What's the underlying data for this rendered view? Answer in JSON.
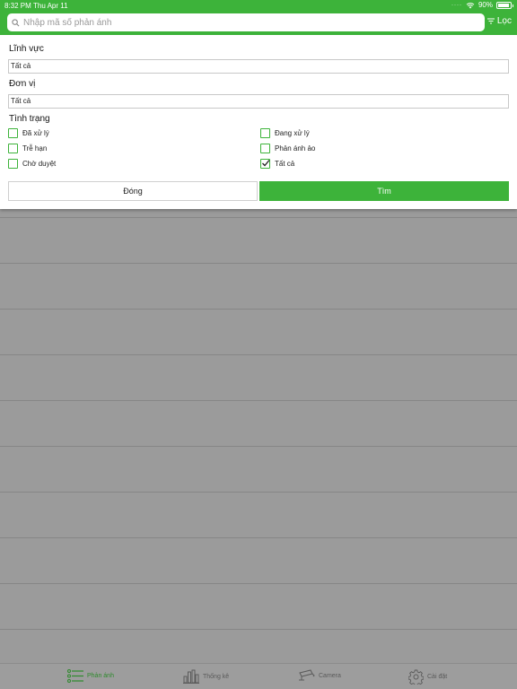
{
  "status": {
    "time": "8:32 PM",
    "date": "Thu Apr 11",
    "battery": "90%",
    "battery_level": 0.9
  },
  "search": {
    "placeholder": "Nhập mã số phản ánh",
    "value": ""
  },
  "header": {
    "filter_label": "Lọc"
  },
  "filter": {
    "field_label": "Lĩnh vực",
    "field_value": "Tất cả",
    "unit_label": "Đơn vị",
    "unit_value": "Tất cả",
    "status_label": "Tình trạng",
    "options": [
      {
        "label": "Đã xử lý",
        "checked": false
      },
      {
        "label": "Đang xử lý",
        "checked": false
      },
      {
        "label": "Trễ hạn",
        "checked": false
      },
      {
        "label": "Phản ánh ảo",
        "checked": false
      },
      {
        "label": "Chờ duyệt",
        "checked": false
      },
      {
        "label": "Tất cả",
        "checked": true
      }
    ],
    "close_label": "Đóng",
    "search_label": "Tìm"
  },
  "tabs": [
    {
      "label": "Phản ánh",
      "icon": "list-icon",
      "active": true
    },
    {
      "label": "Thống kê",
      "icon": "chart-icon",
      "active": false
    },
    {
      "label": "Camera",
      "icon": "camera-icon",
      "active": false
    },
    {
      "label": "Cài đặt",
      "icon": "gear-icon",
      "active": false
    }
  ],
  "colors": {
    "accent": "#3db33a",
    "overlay": "#9b9b9b"
  }
}
